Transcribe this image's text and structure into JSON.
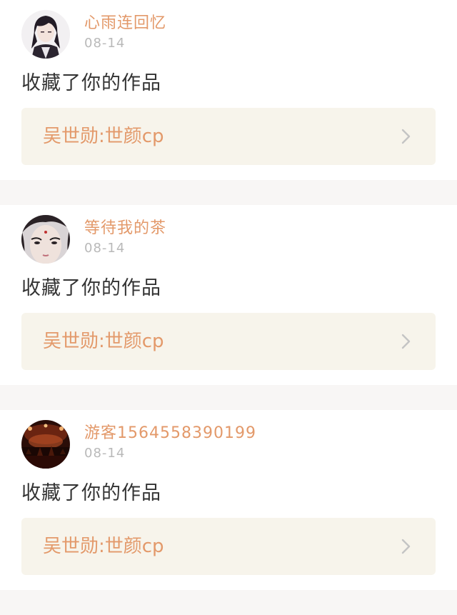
{
  "notifications": [
    {
      "username": "心雨连回忆",
      "date": "08-14",
      "action": "收藏了你的作品",
      "work_title": "吴世勋:世颜cp",
      "avatar": "avatar-dark-haired-anime-boy-icon"
    },
    {
      "username": "等待我的茶",
      "date": "08-14",
      "action": "收藏了你的作品",
      "work_title": "吴世勋:世颜cp",
      "avatar": "avatar-pale-face-dark-hair-icon"
    },
    {
      "username": "游客1564558390199",
      "date": "08-14",
      "action": "收藏了你的作品",
      "work_title": "吴世勋:世颜cp",
      "avatar": "avatar-concert-stage-red-lights-icon"
    }
  ],
  "colors": {
    "accent": "#e3996a",
    "date": "#b9b9b9",
    "text": "#333333",
    "link_bg": "#f7f4eb",
    "separator": "#f8f6f5",
    "chevron": "#c4c4c4"
  }
}
